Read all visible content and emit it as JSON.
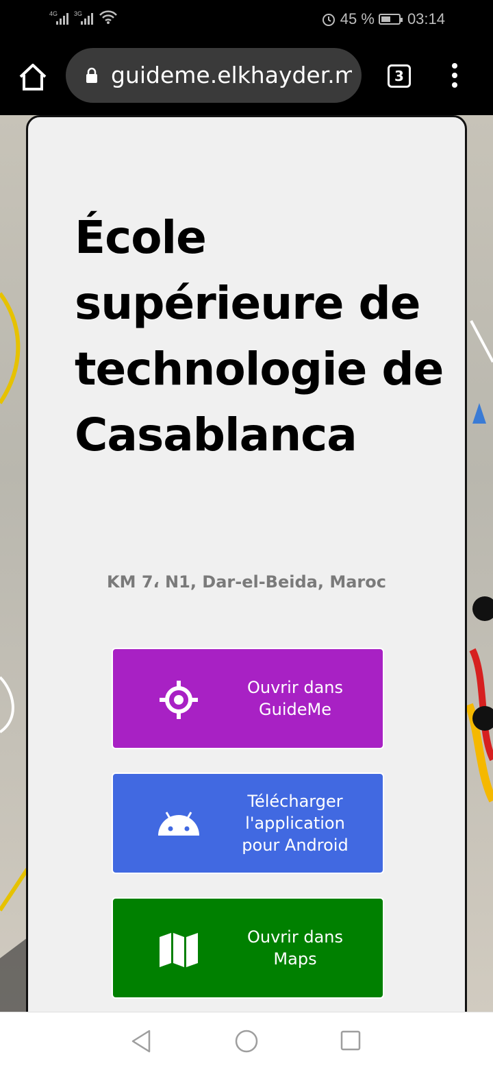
{
  "status_bar": {
    "network1": "4G",
    "network2": "3G",
    "battery": "45 %",
    "time": "03:14"
  },
  "browser": {
    "url": "guideme.elkhayder.me",
    "tab_count": "3"
  },
  "place": {
    "title": "École supérieure de technologie de Casablanca",
    "address": "KM 7، N1, Dar-el-Beida, Maroc"
  },
  "actions": [
    {
      "label": "Ouvrir dans\nGuideMe",
      "icon": "location-target-icon",
      "color": "#a821c4"
    },
    {
      "label": "Télécharger\nl'application\npour Android",
      "icon": "android-icon",
      "color": "#4169e1"
    },
    {
      "label": "Ouvrir dans\nMaps",
      "icon": "map-icon",
      "color": "#008000"
    }
  ]
}
